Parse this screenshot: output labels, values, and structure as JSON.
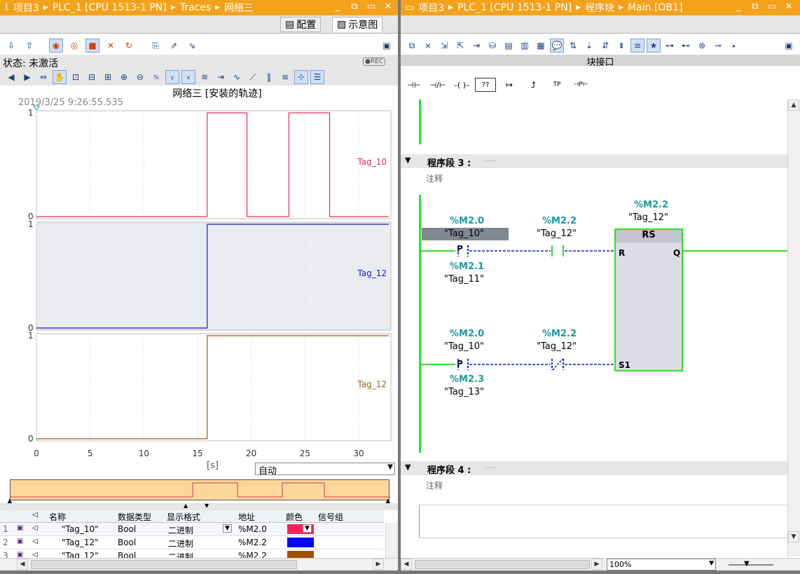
{
  "left": {
    "titlebar": {
      "project": "项目3",
      "plc": "PLC_1 [CPU 1513-1 PN]",
      "traces": "Traces",
      "network": "网络三"
    },
    "tabs": {
      "config": "配置",
      "diagram": "示意图"
    },
    "status": {
      "label": "状态: 未激活",
      "rec": "REC"
    },
    "chart_title": "网络三 [安装的轨迹]",
    "timestamp": "2019/3/25 9:26:55.535",
    "unit_label": "[s]",
    "auto_select": "自动",
    "table": {
      "headers": [
        "名称",
        "数据类型",
        "显示格式",
        "地址",
        "颜色",
        "信号组"
      ],
      "rows": [
        {
          "num": "1",
          "name": "\"Tag_10\"",
          "type": "Bool",
          "format": "二进制",
          "addr": "%M2.0",
          "color": "#f0285a"
        },
        {
          "num": "2",
          "name": "\"Tag_12\"",
          "type": "Bool",
          "format": "二进制",
          "addr": "%M2.2",
          "color": "#0000ff"
        },
        {
          "num": "3",
          "name": "\"Tag_12\"",
          "type": "Bool",
          "format": "二进制",
          "addr": "%M2.2",
          "color": "#a05000"
        }
      ]
    }
  },
  "chart_data": {
    "type": "line",
    "x_ticks": [
      "0",
      "5",
      "10",
      "15",
      "20",
      "25",
      "30"
    ],
    "xlim": [
      0,
      33
    ],
    "series": [
      {
        "name": "Tag_10",
        "color": "#e0305a",
        "values": [
          [
            0,
            0
          ],
          [
            15.9,
            0
          ],
          [
            15.9,
            1
          ],
          [
            19.6,
            1
          ],
          [
            19.6,
            0
          ],
          [
            23.5,
            0
          ],
          [
            23.5,
            1
          ],
          [
            27.3,
            1
          ],
          [
            27.3,
            0
          ],
          [
            32.8,
            0
          ]
        ]
      },
      {
        "name": "Tag_12",
        "color": "#1a1acc",
        "values": [
          [
            0,
            0
          ],
          [
            15.9,
            0
          ],
          [
            15.9,
            1
          ],
          [
            32.8,
            1
          ]
        ]
      },
      {
        "name": "Tag_12",
        "color": "#9a5a10",
        "values": [
          [
            0,
            0
          ],
          [
            15.9,
            0
          ],
          [
            15.9,
            1
          ],
          [
            32.8,
            1
          ]
        ]
      }
    ],
    "ylim": [
      0,
      1
    ],
    "y_ticks": [
      "0",
      "1"
    ]
  },
  "right": {
    "titlebar": {
      "project": "项目3",
      "plc": "PLC_1 [CPU 1513-1 PN]",
      "blocks": "程序块",
      "main": "Main [OB1]"
    },
    "interface_label": "块接口",
    "segment3": {
      "label": "程序段 3 :",
      "dots": ".....",
      "comment": "注释"
    },
    "segment4": {
      "label": "程序段 4 :",
      "dots": ".....",
      "comment": "注释"
    },
    "rung1": {
      "c1_addr": "%M2.0",
      "c1_tag": "\"Tag_10\"",
      "c1_sym": "P",
      "c1_sub_addr": "%M2.1",
      "c1_sub_tag": "\"Tag_11\"",
      "c2_addr": "%M2.2",
      "c2_tag": "\"Tag_12\""
    },
    "rung2": {
      "c1_addr": "%M2.0",
      "c1_tag": "\"Tag_10\"",
      "c1_sym": "P",
      "c1_sub_addr": "%M2.3",
      "c1_sub_tag": "\"Tag_13\"",
      "c2_addr": "%M2.2",
      "c2_tag": "\"Tag_12\""
    },
    "rs": {
      "addr": "%M2.2",
      "tag": "\"Tag_12\"",
      "title": "RS",
      "pin_r": "R",
      "pin_s1": "S1",
      "pin_q": "Q"
    },
    "zoom": "100%",
    "ladder_buttons": [
      "⊣⊢",
      "⊣/⊢",
      "–( )–",
      "??",
      "↦",
      "⮥",
      "TP",
      "⊣P⊢"
    ]
  }
}
